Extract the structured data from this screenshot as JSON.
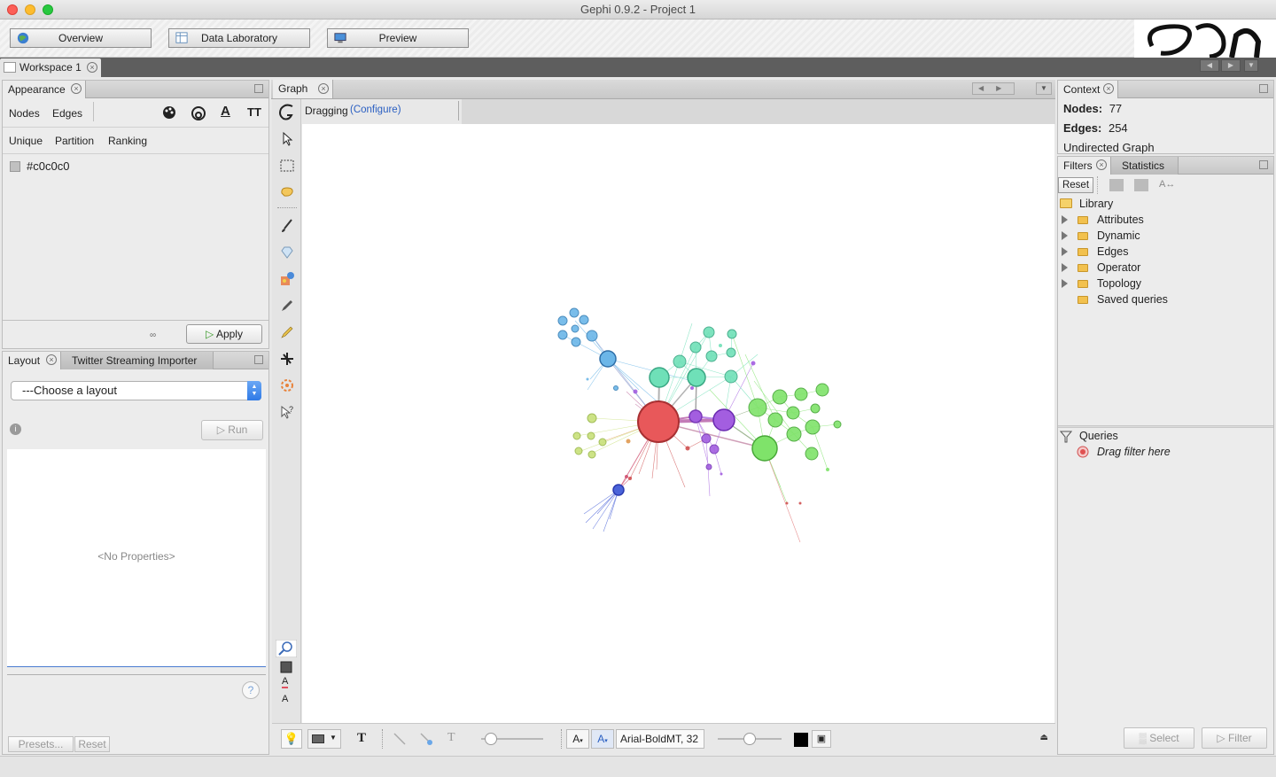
{
  "window": {
    "title": "Gephi 0.9.2 - Project 1"
  },
  "modes": {
    "overview": "Overview",
    "data_lab": "Data Laboratory",
    "preview": "Preview"
  },
  "workspace": {
    "tab": "Workspace 1"
  },
  "appearance": {
    "tab": "Appearance",
    "element_tabs": [
      "Nodes",
      "Edges"
    ],
    "mode_tabs": [
      "Unique",
      "Partition",
      "Ranking"
    ],
    "color_value": "#c0c0c0",
    "color_swatch": "#c0c0c0",
    "apply_label": "Apply"
  },
  "layout": {
    "tab": "Layout",
    "tab2": "Twitter Streaming Importer",
    "select_value": "---Choose a layout",
    "run_label": "Run",
    "no_props": "<No Properties>",
    "presets_label": "Presets...",
    "reset_label": "Reset"
  },
  "graph": {
    "tab": "Graph",
    "mode_label": "Dragging",
    "configure_label": "(Configure)",
    "font_label": "Arial-BoldMT, 32"
  },
  "context": {
    "tab": "Context",
    "nodes_label": "Nodes:",
    "nodes_value": "77",
    "edges_label": "Edges:",
    "edges_value": "254",
    "graph_type": "Undirected Graph"
  },
  "filters": {
    "tab": "Filters",
    "tab2": "Statistics",
    "reset_label": "Reset",
    "library_label": "Library",
    "items": [
      {
        "label": "Attributes",
        "expandable": true
      },
      {
        "label": "Dynamic",
        "expandable": true
      },
      {
        "label": "Edges",
        "expandable": true
      },
      {
        "label": "Operator",
        "expandable": true
      },
      {
        "label": "Topology",
        "expandable": true
      },
      {
        "label": "Saved queries",
        "expandable": false
      }
    ],
    "queries_label": "Queries",
    "drag_hint": "Drag filter here",
    "select_label": "Select",
    "filter_label": "Filter"
  },
  "colors": {
    "cluster_red": "#e8585a",
    "cluster_purple": "#a35ee0",
    "cluster_teal": "#6fe0b8",
    "cluster_green": "#7fe36a",
    "cluster_blue": "#6bb6e8",
    "cluster_darkblue": "#4a63d9",
    "cluster_lime": "#c8e07a"
  }
}
